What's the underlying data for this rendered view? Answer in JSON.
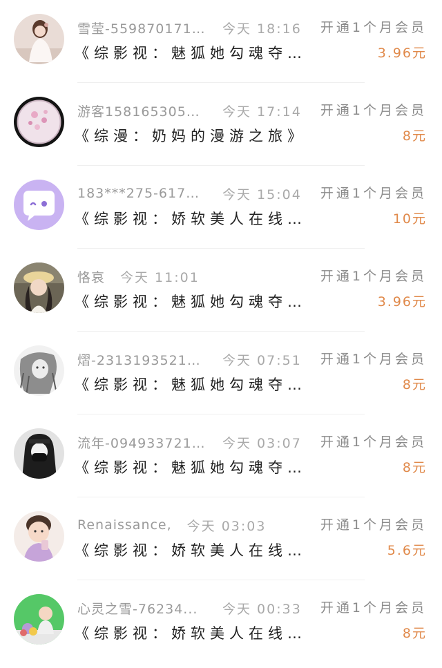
{
  "colors": {
    "price": "#e0894a",
    "meta_text": "#9a9a9a",
    "title_text": "#222222",
    "divider": "#efefef"
  },
  "orders": [
    {
      "avatar": "avatar-girl-white-dress",
      "username": "雪莹-559870171...",
      "time": "今天 18:16",
      "membership": "开通1个月会员",
      "title": "《综影视：魅狐她勾魂夺魄》",
      "price": "3.96元"
    },
    {
      "avatar": "avatar-pink-flower-circle",
      "username": "游客1581653058...",
      "time": "今天 17:14",
      "membership": "开通1个月会员",
      "title": "《综漫：奶妈的漫游之旅》",
      "price": "8元"
    },
    {
      "avatar": "avatar-purple-chat-bubble",
      "username": "183***275-61787...",
      "time": "今天 15:04",
      "membership": "开通1个月会员",
      "title": "《综影视：娇软美人在线崩...",
      "price": "10元"
    },
    {
      "avatar": "avatar-girl-yellow-hat",
      "username": "恪哀",
      "time": "今天 11:01",
      "membership": "开通1个月会员",
      "title": "《综影视：魅狐她勾魂夺魄》",
      "price": "3.96元"
    },
    {
      "avatar": "avatar-sketch-girl",
      "username": "熠-23131935212...",
      "time": "今天 07:51",
      "membership": "开通1个月会员",
      "title": "《综影视：魅狐她勾魂夺魄》",
      "price": "8元"
    },
    {
      "avatar": "avatar-masked-girl",
      "username": "流年-094933721...",
      "time": "今天 03:07",
      "membership": "开通1个月会员",
      "title": "《综影视：魅狐她勾魂夺魄》",
      "price": "8元"
    },
    {
      "avatar": "avatar-toddler-purple",
      "username": "Renaissance,",
      "time": "今天 03:03",
      "membership": "开通1个月会员",
      "title": "《综影视：娇软美人在线崩...",
      "price": "5.6元"
    },
    {
      "avatar": "avatar-baby-green",
      "username": "心灵之雪-76234...",
      "time": "今天 00:33",
      "membership": "开通1个月会员",
      "title": "《综影视：娇软美人在线崩...",
      "price": "8元"
    }
  ]
}
